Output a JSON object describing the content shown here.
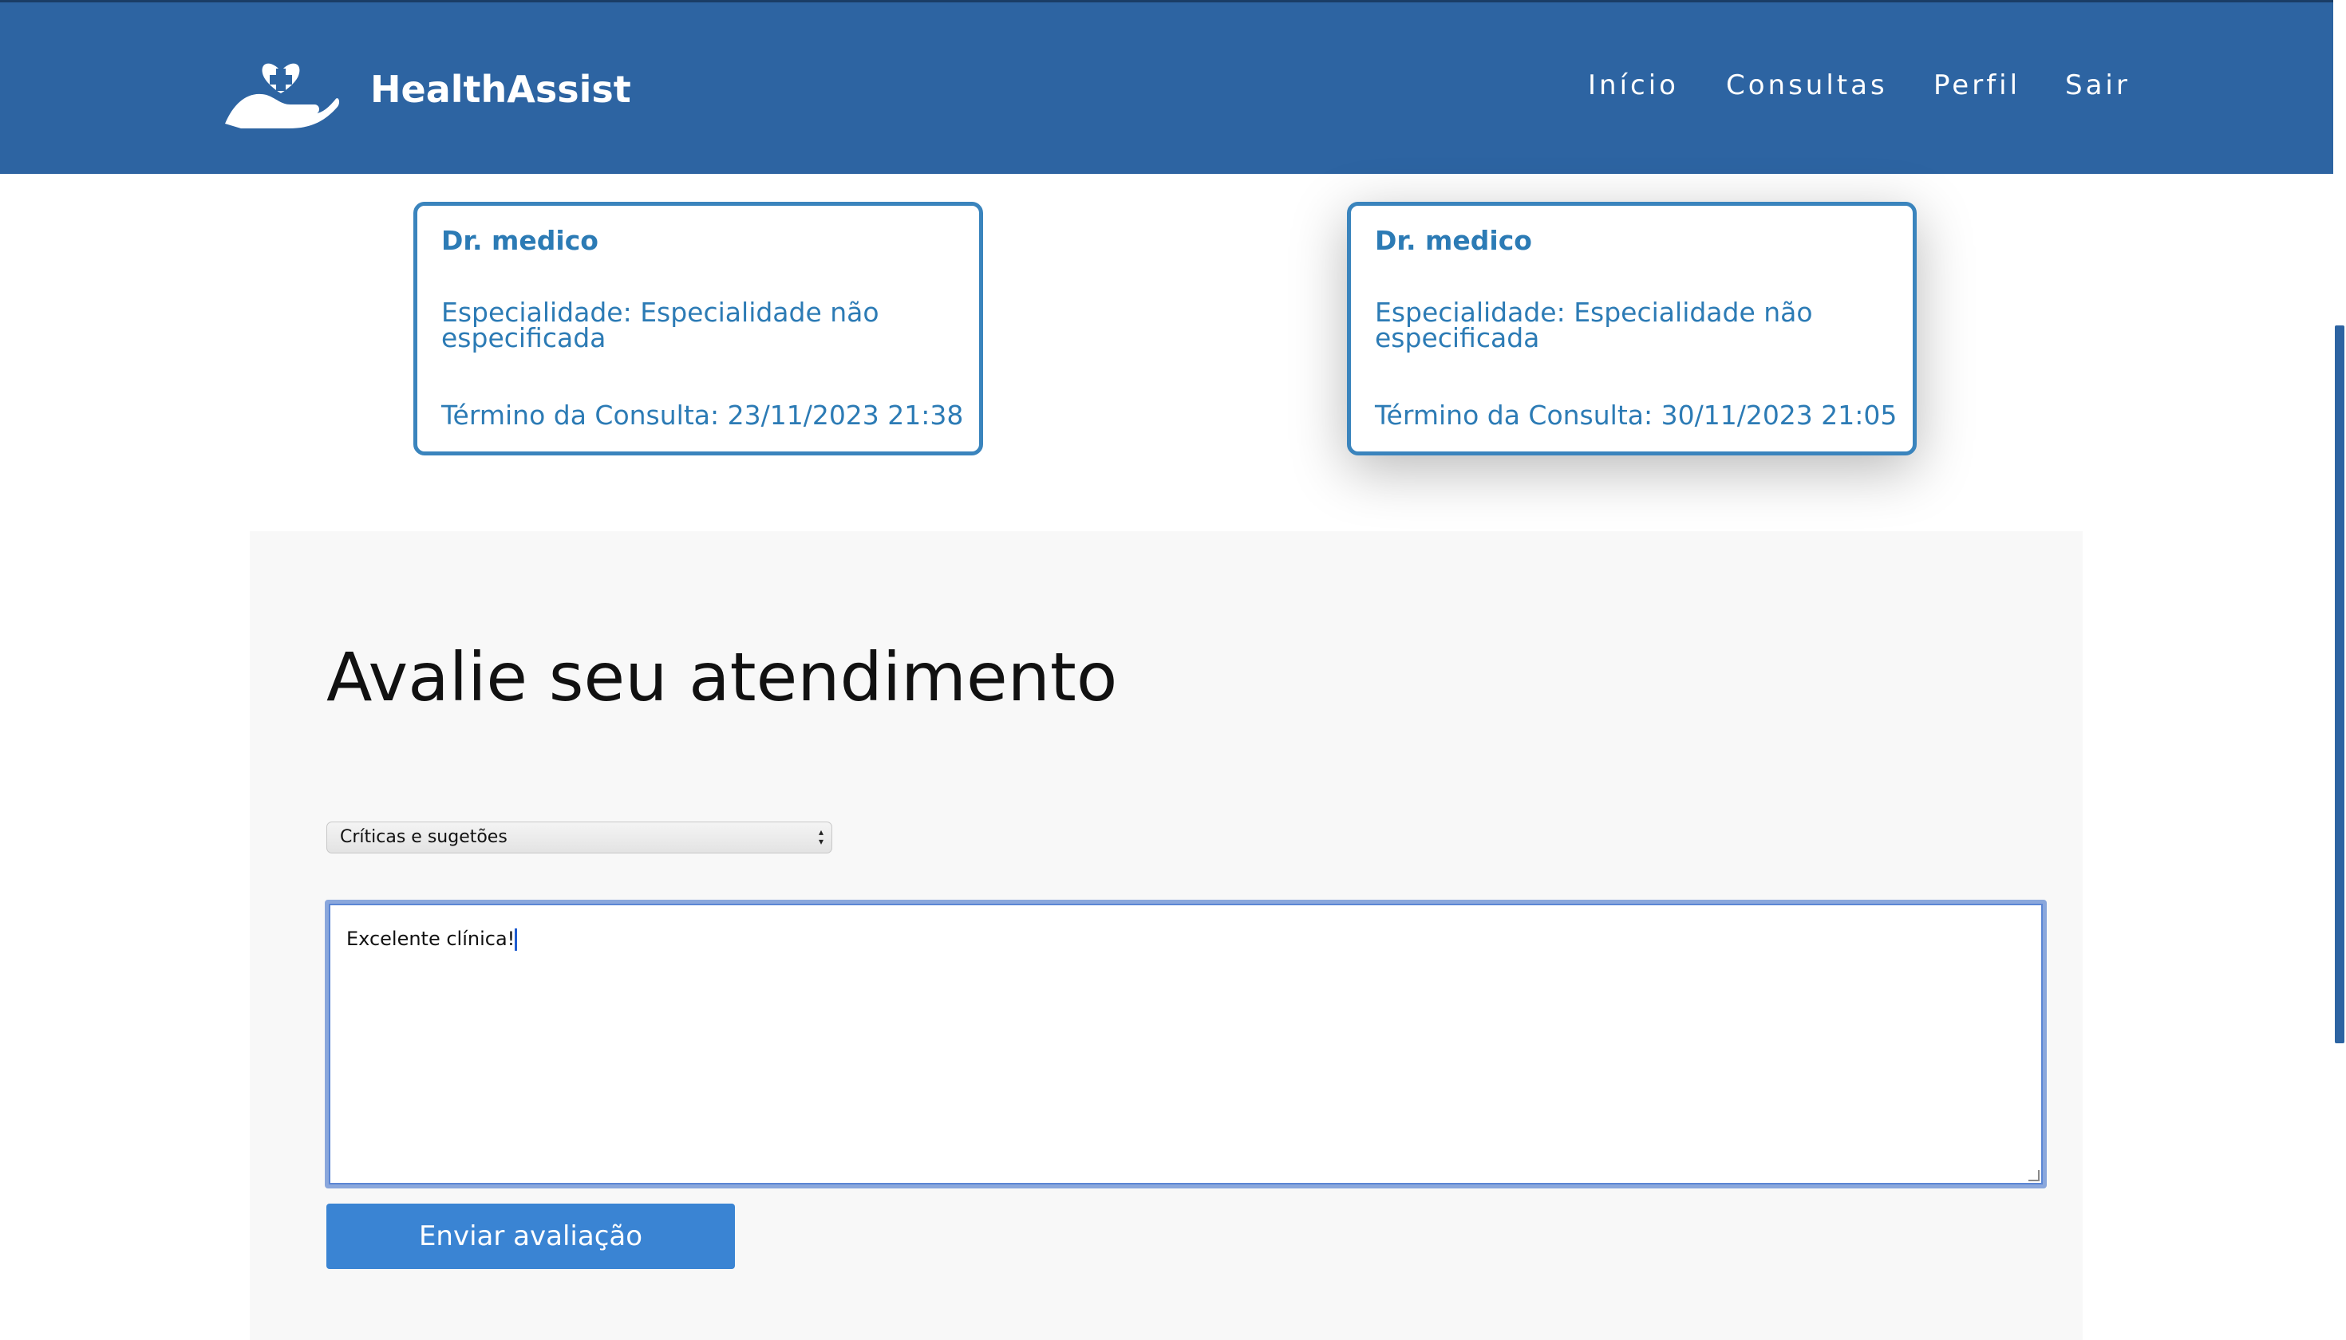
{
  "header": {
    "brand": "HealthAssist",
    "nav": [
      "Início",
      "Consultas",
      "Perfil",
      "Sair"
    ]
  },
  "cards": [
    {
      "name": "Dr. medico",
      "specialty": "Especialidade: Especialidade não especificada",
      "end": "Término da Consulta: 23/11/2023 21:38"
    },
    {
      "name": "Dr. medico",
      "specialty": "Especialidade: Especialidade não especificada",
      "end": "Término da Consulta: 30/11/2023 21:05"
    }
  ],
  "feedback": {
    "title": "Avalie seu atendimento",
    "select_value": "Críticas e sugetões",
    "textarea_value": "Excelente clínica!",
    "submit_label": "Enviar avaliação"
  },
  "colors": {
    "header": "#2d64a2",
    "accent": "#3a84bd",
    "button": "#3a84d3"
  }
}
